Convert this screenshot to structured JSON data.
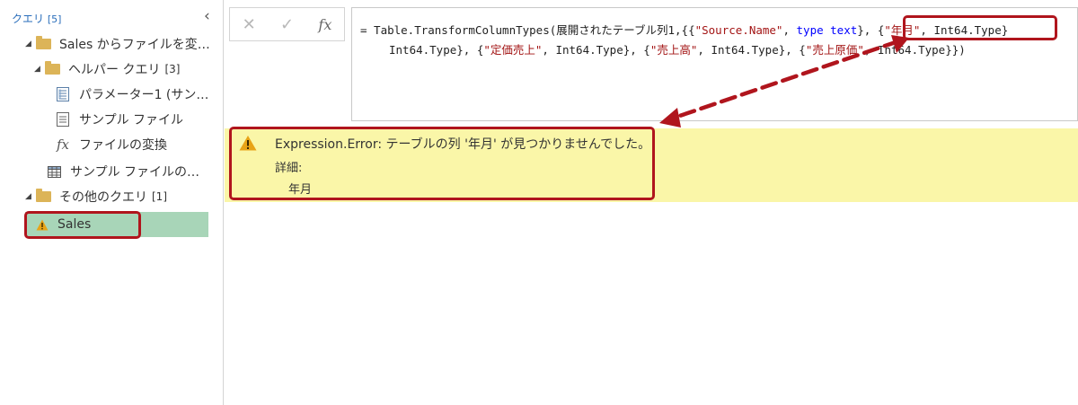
{
  "queries_pane": {
    "header_label": "クエリ",
    "header_count": "[5]",
    "collapse_glyph": "‹",
    "items": [
      {
        "label": "Sales からファイルを変…",
        "type": "group",
        "icon": "folder-icon",
        "expanded": true
      },
      {
        "label": "ヘルパー クエリ",
        "count": "[3]",
        "type": "group",
        "icon": "folder-icon",
        "expanded": true
      },
      {
        "label": "パラメーター1 (サン…",
        "type": "query",
        "icon": "parameter-icon"
      },
      {
        "label": "サンプル ファイル",
        "type": "query",
        "icon": "document-icon"
      },
      {
        "label": "ファイルの変換",
        "type": "query",
        "icon": "function-icon"
      },
      {
        "label": "サンプル ファイルの…",
        "type": "query",
        "icon": "table-icon"
      },
      {
        "label": "その他のクエリ",
        "count": "[1]",
        "type": "group",
        "icon": "folder-icon",
        "expanded": true
      },
      {
        "label": "Sales",
        "type": "query",
        "icon": "warning-icon",
        "selected": true
      }
    ]
  },
  "formula_bar": {
    "cancel_glyph": "✕",
    "commit_glyph": "✓",
    "fx_label": "fx",
    "line1": {
      "p1": "= Table.TransformColumnTypes(展開されたテーブル列1,{{",
      "s1": "\"Source.Name\"",
      "p2": ", ",
      "kw": "type text",
      "p3": "}, {",
      "s2": "\"年月\"",
      "p4": ", Int64.Type}"
    },
    "line2": {
      "p1": "Int64.Type}, {",
      "s1": "\"定価売上\"",
      "p2": ", Int64.Type}, {",
      "s2": "\"売上高\"",
      "p3": ", Int64.Type}, {",
      "s3": "\"売上原価\"",
      "p4": ", Int64.Type}})"
    }
  },
  "error_banner": {
    "title": "Expression.Error: テーブルの列 '年月' が見つかりませんでした。",
    "detail_label": "詳細:",
    "detail_value": "年月"
  },
  "colors": {
    "annotation_red": "#b0151d",
    "error_background": "#faf6a8",
    "selected_row": "#a8d5b8",
    "folder": "#dcb458",
    "warning": "#e8a317"
  }
}
